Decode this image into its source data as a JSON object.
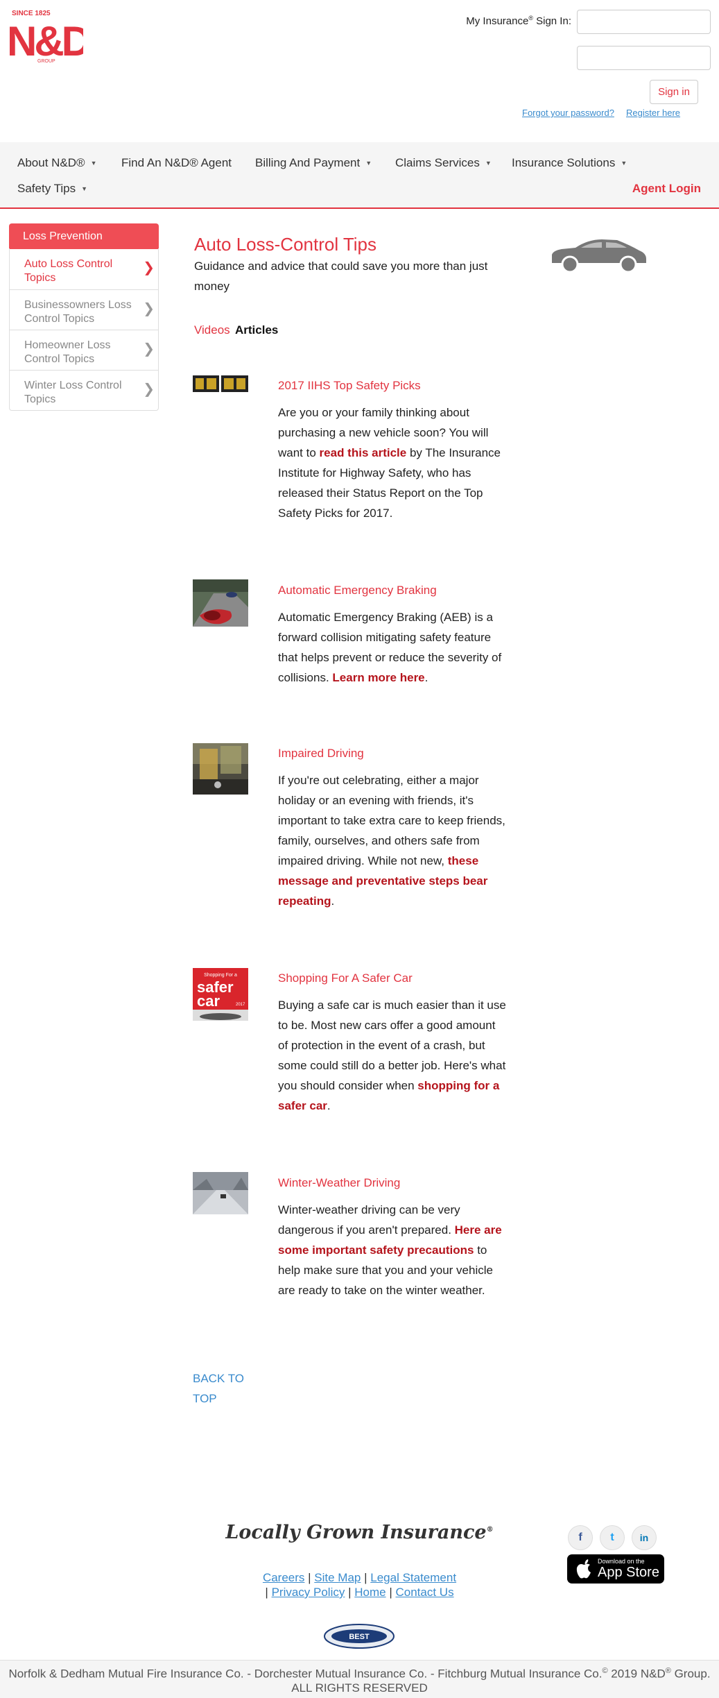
{
  "header": {
    "logo_since": "SINCE 1825",
    "logo_mark": "N&D",
    "logo_group": "GROUP",
    "signin_label": "My Insurance",
    "signin_reg": "®",
    "signin_suffix": " Sign In:",
    "username_value": "",
    "password_value": "",
    "signin_button": "Sign in",
    "forgot_password": "Forgot your password?",
    "register": "Register here"
  },
  "nav": {
    "items": [
      {
        "label": "About N&D®",
        "dropdown": true
      },
      {
        "label": "Find An N&D® Agent",
        "dropdown": false
      },
      {
        "label": "Billing And Payment",
        "dropdown": true
      },
      {
        "label": "Claims Services",
        "dropdown": true
      },
      {
        "label": "Insurance Solutions",
        "dropdown": true
      },
      {
        "label": "Safety Tips",
        "dropdown": true
      }
    ],
    "caret": "▼",
    "agent_login": "Agent Login"
  },
  "sidebar": {
    "heading": "Loss Prevention",
    "items": [
      {
        "label": "Auto Loss Control Topics",
        "active": true
      },
      {
        "label": "Businessowners Loss Control Topics",
        "active": false
      },
      {
        "label": "Homeowner Loss Control Topics",
        "active": false
      },
      {
        "label": "Winter Loss Control Topics",
        "active": false
      }
    ]
  },
  "main": {
    "title": "Auto Loss-Control Tips",
    "subtitle": "Guidance and advice that could save you more than just money",
    "tabs": {
      "videos": "Videos",
      "articles": "Articles"
    },
    "articles": [
      {
        "title": "2017 IIHS Top Safety Picks",
        "pre": "Are you or your family thinking about purchasing a new vehicle soon? You will want to ",
        "link": "read this article",
        "post": " by The Insurance Institute for Highway Safety, who has released their Status Report on the Top Safety Picks for 2017.",
        "thumb": "iihs-safety-badges"
      },
      {
        "title": "Automatic Emergency Braking",
        "pre": "Automatic Emergency Braking (AEB) is a forward collision mitigating safety feature that helps prevent or reduce the severity of collisions. ",
        "link": "Learn more here",
        "post": ".",
        "thumb": "cars-on-road-photo"
      },
      {
        "title": "Impaired Driving",
        "pre": "If you're out celebrating, either a major holiday or an evening with friends, it's important to take extra care to keep friends, family, ourselves, and others safe from impaired driving. While not new, ",
        "link": "these message and preventative steps bear repeating",
        "post": ".",
        "thumb": "drink-and-keys-photo"
      },
      {
        "title": "Shopping For A Safer Car",
        "pre": "Buying a safe car is much easier than it use to be. Most new cars offer a good amount of protection in the event of a crash, but some could still do a better job. Here's what you should consider when ",
        "link": "shopping for a safer car",
        "post": ".",
        "thumb": "safer-car-magazine",
        "thumb_text_small": "Shopping For a",
        "thumb_text_big1": "safer",
        "thumb_text_big2": "car",
        "thumb_text_year": "2017"
      },
      {
        "title": "Winter-Weather Driving",
        "pre": "Winter-weather driving can be very dangerous if you aren't prepared.  ",
        "link": "Here are some important safety precautions",
        "post": " to help make sure that you and your vehicle are ready to take on the winter weather.",
        "thumb": "snowy-road-photo"
      }
    ],
    "back_to_top": "BACK TO TOP"
  },
  "footer": {
    "tagline": "Locally Grown Insurance",
    "tagline_reg": "®",
    "social": [
      {
        "name": "facebook-icon",
        "glyph": "f",
        "color": "#3b5998"
      },
      {
        "name": "twitter-icon",
        "glyph": "t",
        "color": "#1da1f2"
      },
      {
        "name": "linkedin-icon",
        "glyph": "in",
        "color": "#0077b5"
      }
    ],
    "appstore_small": "Download on the",
    "appstore_big": "App Store",
    "links": [
      "Careers",
      "Site Map",
      "Legal Statement",
      "Privacy Policy",
      "Home",
      "Contact Us"
    ],
    "ambest_label": "BEST",
    "copyright_pre": "Norfolk & Dedham Mutual Fire Insurance Co. - Dorchester Mutual Insurance Co. - Fitchburg Mutual Insurance Co.",
    "copyright_sup": "©",
    "copyright_post": " 2019 N&D",
    "copyright_reg": "®",
    "copyright_end": " Group.",
    "copyright_line2": "ALL RIGHTS RESERVED"
  },
  "colors": {
    "brand_red": "#e23440",
    "dark_red_link": "#b5141c",
    "link_blue": "#3a8bcd",
    "nav_bg": "#f5f5f5"
  }
}
